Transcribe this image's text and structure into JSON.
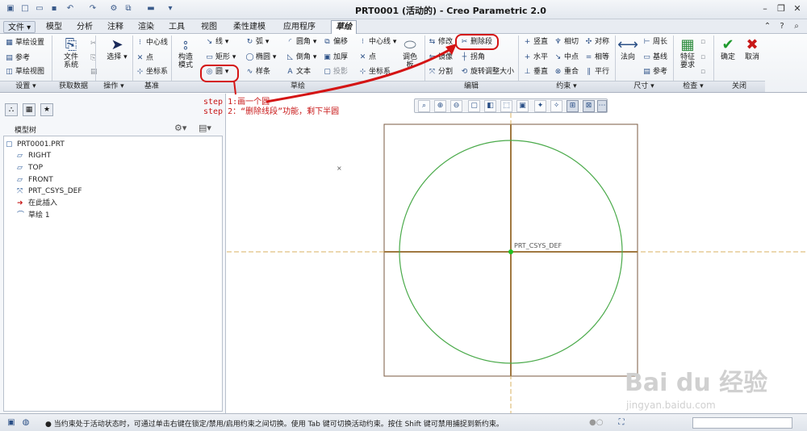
{
  "window": {
    "title": "PRT0001 (活动的) - Creo Parametric 2.0"
  },
  "menu": {
    "tabs": [
      "文件",
      "模型",
      "分析",
      "注释",
      "渲染",
      "工具",
      "视图",
      "柔性建模",
      "应用程序",
      "草绘"
    ],
    "active": "草绘"
  },
  "ribbon": {
    "setup": {
      "sketch_setup": "草绘设置",
      "reference": "参考",
      "sketch_view": "草绘视图",
      "group": "设置"
    },
    "get_data": {
      "file_system": "文件\n系统",
      "group": "获取数据"
    },
    "operations": {
      "select": "选择",
      "group": "操作"
    },
    "datum": {
      "centerline": "中心线",
      "point": "点",
      "coord_sys": "坐标系",
      "group": "基准"
    },
    "sketch": {
      "construction_mode": "构造\n模式",
      "line": "线",
      "rectangle": "矩形",
      "circle": "圆",
      "arc": "弧",
      "ellipse": "椭圆",
      "spline": "样条",
      "fillet": "圆角",
      "chamfer": "倒角",
      "text": "文本",
      "offset": "偏移",
      "thicken": "加厚",
      "project": "投影",
      "centerline": "中心线",
      "point": "点",
      "coord_sys": "坐标系",
      "palette": "调色\n板",
      "group": "草绘"
    },
    "editing": {
      "modify": "修改",
      "mirror": "镜像",
      "divide": "分割",
      "delete_segment": "删除段",
      "corner": "拐角",
      "rotate_resize": "旋转调整大小",
      "group": "编辑"
    },
    "constrain": {
      "vertical": "竖直",
      "horizontal": "水平",
      "perpendicular": "垂直",
      "tangent": "相切",
      "midpoint": "中点",
      "coincident": "重合",
      "symmetric": "对称",
      "equal": "相等",
      "parallel": "平行",
      "group": "约束"
    },
    "dimension": {
      "normal": "法向",
      "perimeter": "周长",
      "baseline": "基线",
      "reference": "参考",
      "group": "尺寸"
    },
    "inspect": {
      "feature_req": "特征\n要求",
      "group": "检查"
    },
    "close": {
      "ok": "确定",
      "cancel": "取消",
      "group": "关闭"
    }
  },
  "annotation": {
    "step1": "step 1:画一个圆",
    "step2": "step 2：“删除线段”功能，剩下半圆"
  },
  "model_tree": {
    "title": "模型树",
    "items": [
      "PRT0001.PRT",
      "RIGHT",
      "TOP",
      "FRONT",
      "PRT_CSYS_DEF",
      "在此插入",
      "草绘 1"
    ]
  },
  "graphics": {
    "csys_label": "PRT_CSYS_DEF"
  },
  "status": {
    "message": "● 当约束处于活动状态时，可通过单击右键在锁定/禁用/启用约束之间切换。使用 Tab 键可切换活动约束。按住 Shift 键可禁用捕捉到新约束。"
  },
  "watermark": {
    "brand": "Bai du 经验",
    "url": "jingyan.baidu.com"
  },
  "colors": {
    "annotation_red": "#d41414",
    "sketch_circle": "#4aaa4a",
    "datum_brown": "#b07830",
    "csys_green": "#20c020"
  }
}
